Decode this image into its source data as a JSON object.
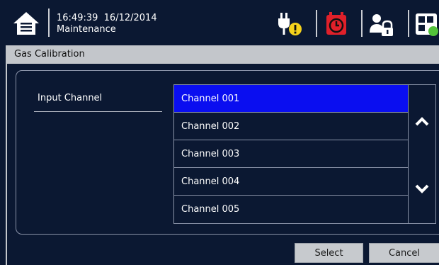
{
  "header": {
    "time": "16:49:39",
    "date": "16/12/2014",
    "mode": "Maintenance",
    "icons": [
      "home-icon",
      "power-warning-icon",
      "alarm-clock-icon",
      "user-lock-icon",
      "layout-grid-icon"
    ],
    "colors": {
      "background": "#0b1832",
      "alarm": "#e0202a",
      "warning": "#f5d21c",
      "accent_green": "#52c23a"
    }
  },
  "page": {
    "title": "Gas Calibration"
  },
  "form": {
    "label": "Input Channel",
    "channels": [
      "Channel 001",
      "Channel 002",
      "Channel 003",
      "Channel 004",
      "Channel 005"
    ],
    "selected": "Channel 001",
    "selected_color": "#0a0ef0"
  },
  "actions": {
    "select_label": "Select",
    "cancel_label": "Cancel"
  }
}
